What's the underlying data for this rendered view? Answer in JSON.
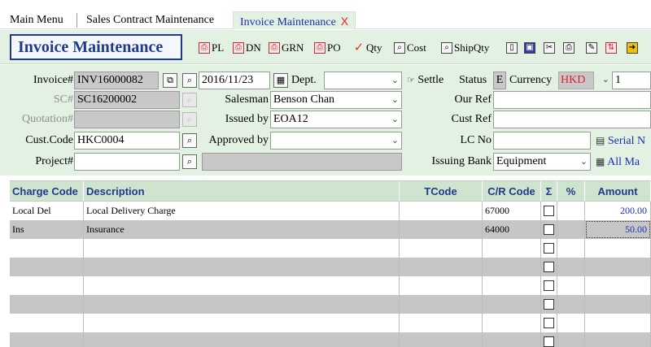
{
  "tabs": [
    {
      "label": "Main Menu"
    },
    {
      "label": "Sales Contract Maintenance"
    },
    {
      "label": "Invoice Maintenance",
      "close": "X"
    }
  ],
  "toolbar": {
    "title": "Invoice Maintenance",
    "buttons": [
      {
        "label": "PL",
        "icon": "print-icon"
      },
      {
        "label": "DN",
        "icon": "print-icon"
      },
      {
        "label": "GRN",
        "icon": "print-icon"
      },
      {
        "label": "PO",
        "icon": "print-icon"
      },
      {
        "label": "Qty",
        "icon": "check-icon"
      },
      {
        "label": "Cost",
        "icon": "search-icon"
      },
      {
        "label": "ShipQty",
        "icon": "search-icon"
      }
    ]
  },
  "form": {
    "invoice_label": "Invoice#",
    "invoice_value": "INV16000082",
    "date_value": "2016/11/23",
    "dept_label": "Dept.",
    "dept_value": "",
    "settle_label": "Settle",
    "status_label": "Status",
    "status_value": "E",
    "currency_label": "Currency",
    "currency_value": "HKD",
    "rate_value": "1",
    "sc_label": "SC#",
    "sc_value": "SC16200002",
    "salesman_label": "Salesman",
    "salesman_value": "Benson Chan",
    "our_ref_label": "Our Ref",
    "our_ref_value": "",
    "quotation_label": "Quotation#",
    "quotation_value": "",
    "issued_by_label": "Issued by",
    "issued_by_value": "EOA12",
    "cust_ref_label": "Cust Ref",
    "cust_ref_value": "",
    "cust_code_label": "Cust.Code",
    "cust_code_value": "HKC0004",
    "approved_by_label": "Approved by",
    "approved_by_value": "",
    "lc_no_label": "LC No",
    "lc_no_value": "",
    "serial_label": "Serial N",
    "project_label": "Project#",
    "project_value": "",
    "issuing_bank_label": "Issuing Bank",
    "issuing_bank_value": "Equipment",
    "all_label": "All Ma"
  },
  "grid": {
    "headers": [
      "Charge Code",
      "Description",
      "TCode",
      "C/R Code",
      "Σ",
      "%",
      "Amount"
    ],
    "rows": [
      {
        "charge_code": "Local Del",
        "description": "Local Delivery Charge",
        "tcode": "",
        "cr_code": "67000",
        "amount": "200.00"
      },
      {
        "charge_code": "Ins",
        "description": "Insurance",
        "tcode": "",
        "cr_code": "64000",
        "amount": "50.00"
      },
      {
        "charge_code": "",
        "description": "",
        "tcode": "",
        "cr_code": "",
        "amount": ""
      },
      {
        "charge_code": "",
        "description": "",
        "tcode": "",
        "cr_code": "",
        "amount": ""
      },
      {
        "charge_code": "",
        "description": "",
        "tcode": "",
        "cr_code": "",
        "amount": ""
      },
      {
        "charge_code": "",
        "description": "",
        "tcode": "",
        "cr_code": "",
        "amount": ""
      },
      {
        "charge_code": "",
        "description": "",
        "tcode": "",
        "cr_code": "",
        "amount": ""
      },
      {
        "charge_code": "",
        "description": "",
        "tcode": "",
        "cr_code": "",
        "amount": ""
      }
    ]
  }
}
